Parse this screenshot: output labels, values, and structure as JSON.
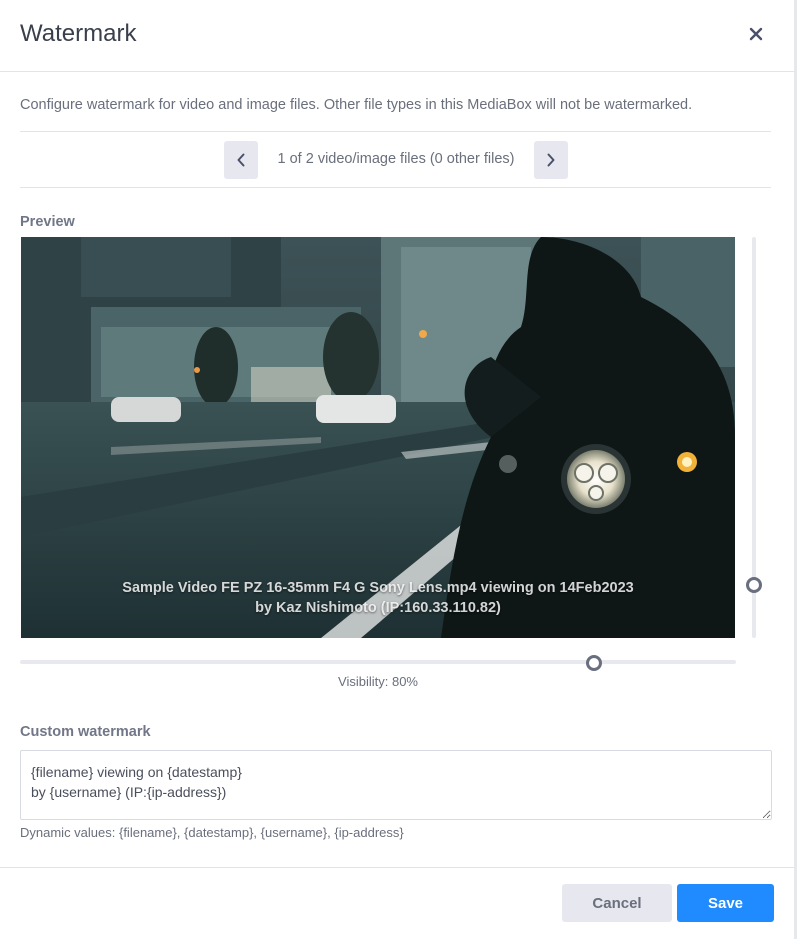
{
  "dialog": {
    "title": "Watermark",
    "description": "Configure watermark for video and image files. Other file types in this MediaBox will not be watermarked."
  },
  "pager": {
    "text": "1 of 2 video/image files (0 other files)",
    "prev_icon": "chevron-left-icon",
    "next_icon": "chevron-right-icon"
  },
  "preview": {
    "label": "Preview",
    "watermark_line1": "Sample Video FE PZ 16-35mm F4 G Sony Lens.mp4 viewing on 14Feb2023",
    "watermark_line2": "by Kaz Nishimoto (IP:160.33.110.82)"
  },
  "visibility": {
    "label": "Visibility: 80%",
    "value_percent": 80
  },
  "custom_watermark": {
    "label": "Custom watermark",
    "value": "{filename} viewing on {datestamp}\nby {username} (IP:{ip-address})",
    "hint": "Dynamic values: {filename}, {datestamp}, {username}, {ip-address}"
  },
  "footer": {
    "cancel_label": "Cancel",
    "save_label": "Save"
  },
  "colors": {
    "accent": "#1f8bff",
    "button_secondary": "#e7e8ef"
  }
}
